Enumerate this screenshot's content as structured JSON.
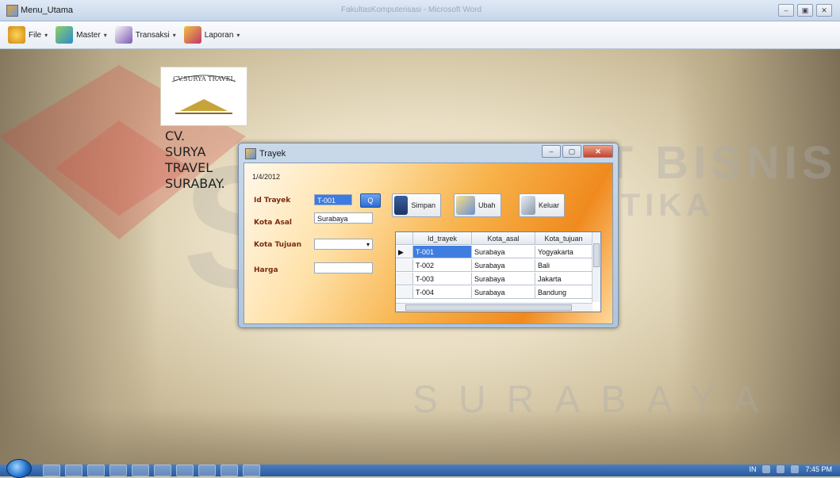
{
  "window": {
    "title": "Menu_Utama",
    "background_title_faded": "FakultasKomputerisasi - Microsoft Word"
  },
  "menubar": {
    "items": [
      {
        "label": "File"
      },
      {
        "label": "Master"
      },
      {
        "label": "Transaksi"
      },
      {
        "label": "Laporan"
      }
    ]
  },
  "company": {
    "logo_text": "CV.SURYA TRAVEL",
    "name_lines": [
      "CV.",
      "SURYA",
      "TRAVEL",
      "SURABAY."
    ]
  },
  "watermark": {
    "line1": "INSTITUT BISNIS",
    "line2": "& INFORMATIKA",
    "line3": "SURABAYA"
  },
  "dialog": {
    "title": "Trayek",
    "date": "1/4/2012",
    "labels": {
      "id_trayek": "Id Trayek",
      "kota_asal": "Kota Asal",
      "kota_tujuan": "Kota Tujuan",
      "harga": "Harga"
    },
    "values": {
      "id_trayek": "T-001",
      "kota_asal": "Surabaya",
      "kota_tujuan": "",
      "harga": ""
    },
    "search_label": "Q",
    "buttons": {
      "simpan": "Simpan",
      "ubah": "Ubah",
      "keluar": "Keluar"
    },
    "grid": {
      "columns": [
        "Id_trayek",
        "Kota_asal",
        "Kota_tujuan"
      ],
      "rows": [
        [
          "T-001",
          "Surabaya",
          "Yogyakarta"
        ],
        [
          "T-002",
          "Surabaya",
          "Bali"
        ],
        [
          "T-003",
          "Surabaya",
          "Jakarta"
        ],
        [
          "T-004",
          "Surabaya",
          "Bandung"
        ]
      ],
      "row_indicator": "▶"
    }
  },
  "taskbar": {
    "clock": "7:45 PM",
    "lang": "IN"
  },
  "colors": {
    "dialog_orange": "#f08a1e",
    "selection_blue": "#3f7ee0"
  }
}
